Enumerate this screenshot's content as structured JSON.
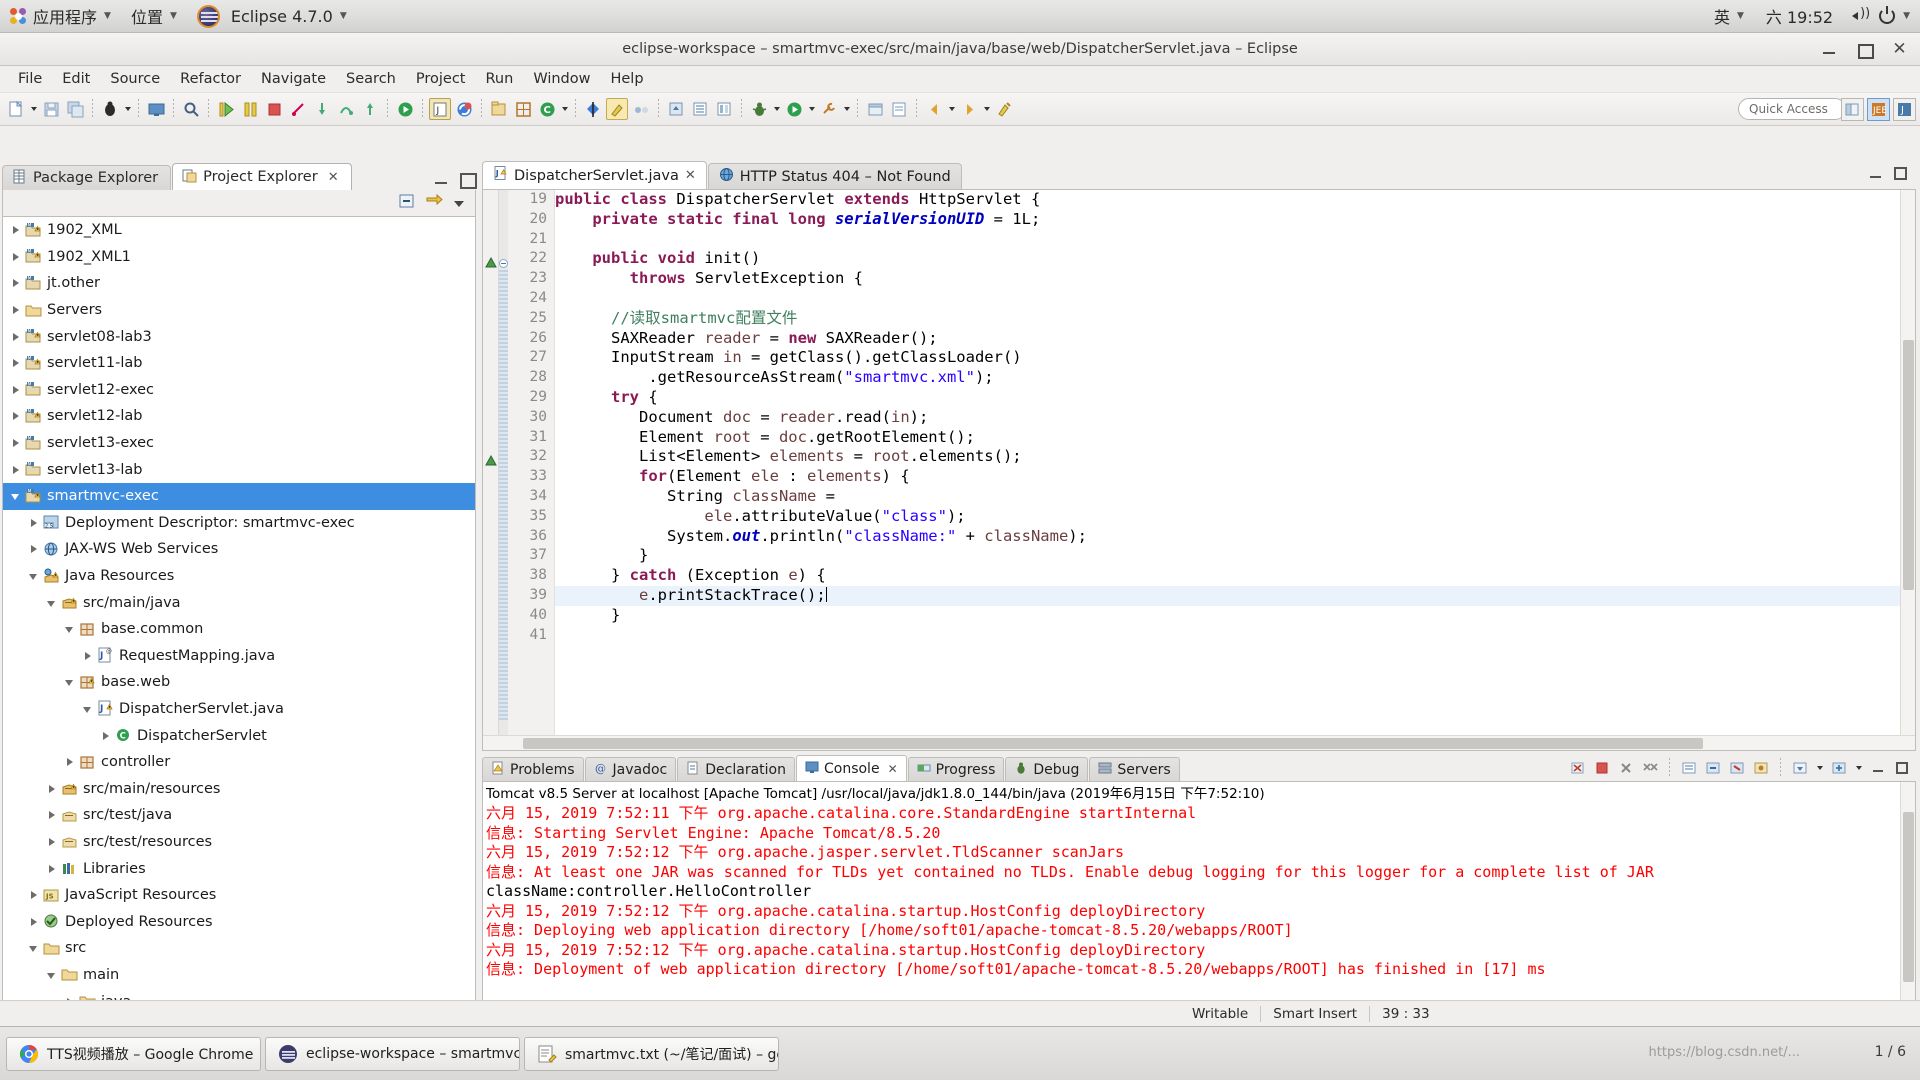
{
  "gnome_panel": {
    "applications_label": "应用程序",
    "places_label": "位置",
    "app_menu_label": "Eclipse 4.7.0",
    "input_method": "英",
    "clock": "六 19:52"
  },
  "window": {
    "title": "eclipse-workspace – smartmvc-exec/src/main/java/base/web/DispatcherServlet.java – Eclipse"
  },
  "menubar": [
    "File",
    "Edit",
    "Source",
    "Refactor",
    "Navigate",
    "Search",
    "Project",
    "Run",
    "Window",
    "Help"
  ],
  "toolbar": {
    "quick_access_placeholder": "Quick Access"
  },
  "left_view": {
    "tabs": [
      {
        "label": "Package Explorer",
        "active": false
      },
      {
        "label": "Project Explorer",
        "active": true
      }
    ],
    "tree": [
      {
        "label": "1902_XML",
        "depth": 0,
        "arrow": "right",
        "icon": "maven-project-warning"
      },
      {
        "label": "1902_XML1",
        "depth": 0,
        "arrow": "right",
        "icon": "maven-project-warning"
      },
      {
        "label": "jt.other",
        "depth": 0,
        "arrow": "right",
        "icon": "maven-project"
      },
      {
        "label": "Servers",
        "depth": 0,
        "arrow": "right",
        "icon": "folder"
      },
      {
        "label": "servlet08-lab3",
        "depth": 0,
        "arrow": "right",
        "icon": "maven-project-warning"
      },
      {
        "label": "servlet11-lab",
        "depth": 0,
        "arrow": "right",
        "icon": "maven-project-warning"
      },
      {
        "label": "servlet12-exec",
        "depth": 0,
        "arrow": "right",
        "icon": "maven-project"
      },
      {
        "label": "servlet12-lab",
        "depth": 0,
        "arrow": "right",
        "icon": "maven-project-warning"
      },
      {
        "label": "servlet13-exec",
        "depth": 0,
        "arrow": "right",
        "icon": "maven-project"
      },
      {
        "label": "servlet13-lab",
        "depth": 0,
        "arrow": "right",
        "icon": "maven-project"
      },
      {
        "label": "smartmvc-exec",
        "depth": 0,
        "arrow": "down",
        "icon": "maven-project-warning",
        "selected": true
      },
      {
        "label": "Deployment Descriptor: smartmvc-exec",
        "depth": 1,
        "arrow": "right",
        "icon": "deployment-descriptor"
      },
      {
        "label": "JAX-WS Web Services",
        "depth": 1,
        "arrow": "right",
        "icon": "jaxws"
      },
      {
        "label": "Java Resources",
        "depth": 1,
        "arrow": "down",
        "icon": "java-resources-warning"
      },
      {
        "label": "src/main/java",
        "depth": 2,
        "arrow": "down",
        "icon": "source-folder-warning"
      },
      {
        "label": "base.common",
        "depth": 3,
        "arrow": "down",
        "icon": "package"
      },
      {
        "label": "RequestMapping.java",
        "depth": 4,
        "arrow": "right",
        "icon": "annotation-file"
      },
      {
        "label": "base.web",
        "depth": 3,
        "arrow": "down",
        "icon": "package-warning"
      },
      {
        "label": "DispatcherServlet.java",
        "depth": 4,
        "arrow": "down",
        "icon": "java-file-warning"
      },
      {
        "label": "DispatcherServlet",
        "depth": 5,
        "arrow": "right",
        "icon": "class"
      },
      {
        "label": "controller",
        "depth": 3,
        "arrow": "right",
        "icon": "package"
      },
      {
        "label": "src/main/resources",
        "depth": 2,
        "arrow": "right",
        "icon": "source-folder-warning"
      },
      {
        "label": "src/test/java",
        "depth": 2,
        "arrow": "right",
        "icon": "source-folder"
      },
      {
        "label": "src/test/resources",
        "depth": 2,
        "arrow": "right",
        "icon": "source-folder"
      },
      {
        "label": "Libraries",
        "depth": 2,
        "arrow": "right",
        "icon": "libraries"
      },
      {
        "label": "JavaScript Resources",
        "depth": 1,
        "arrow": "right",
        "icon": "js-resources"
      },
      {
        "label": "Deployed Resources",
        "depth": 1,
        "arrow": "right",
        "icon": "deployed-resources"
      },
      {
        "label": "src",
        "depth": 1,
        "arrow": "down",
        "icon": "folder"
      },
      {
        "label": "main",
        "depth": 2,
        "arrow": "down",
        "icon": "folder"
      },
      {
        "label": "java",
        "depth": 3,
        "arrow": "right",
        "icon": "folder"
      }
    ]
  },
  "editor": {
    "tabs": [
      {
        "label": "DispatcherServlet.java",
        "active": true,
        "icon": "java-file-warning",
        "closable": true
      },
      {
        "label": "HTTP Status 404 – Not Found",
        "active": false,
        "icon": "globe",
        "closable": false
      }
    ],
    "first_line_number": 19,
    "lines": [
      {
        "n": 19,
        "segs": [
          {
            "t": "public ",
            "c": "kw"
          },
          {
            "t": "class ",
            "c": "kw"
          },
          {
            "t": "DispatcherServlet ",
            "c": "plain"
          },
          {
            "t": "extends ",
            "c": "kw"
          },
          {
            "t": "HttpServlet {",
            "c": "plain"
          }
        ]
      },
      {
        "n": 20,
        "segs": [
          {
            "t": "    ",
            "c": "plain"
          },
          {
            "t": "private static final ",
            "c": "kw"
          },
          {
            "t": "long ",
            "c": "kw"
          },
          {
            "t": "serialVersionUID",
            "c": "stat"
          },
          {
            "t": " = 1L;",
            "c": "plain"
          }
        ]
      },
      {
        "n": 21,
        "segs": []
      },
      {
        "n": 22,
        "segs": [
          {
            "t": "    ",
            "c": "plain"
          },
          {
            "t": "public void ",
            "c": "kw"
          },
          {
            "t": "init()",
            "c": "plain"
          }
        ],
        "fold": true,
        "marker": true
      },
      {
        "n": 23,
        "segs": [
          {
            "t": "        ",
            "c": "plain"
          },
          {
            "t": "throws ",
            "c": "kw"
          },
          {
            "t": "ServletException {",
            "c": "plain"
          }
        ]
      },
      {
        "n": 24,
        "segs": []
      },
      {
        "n": 25,
        "segs": [
          {
            "t": "      ",
            "c": "plain"
          },
          {
            "t": "//读取smartmvc配置文件",
            "c": "cmt"
          }
        ]
      },
      {
        "n": 26,
        "segs": [
          {
            "t": "      SAXReader ",
            "c": "plain"
          },
          {
            "t": "reader",
            "c": "loc"
          },
          {
            "t": " = ",
            "c": "plain"
          },
          {
            "t": "new ",
            "c": "kw"
          },
          {
            "t": "SAXReader();",
            "c": "plain"
          }
        ]
      },
      {
        "n": 27,
        "segs": [
          {
            "t": "      InputStream ",
            "c": "plain"
          },
          {
            "t": "in",
            "c": "loc"
          },
          {
            "t": " = getClass().getClassLoader()",
            "c": "plain"
          }
        ]
      },
      {
        "n": 28,
        "segs": [
          {
            "t": "          .getResourceAsStream(",
            "c": "plain"
          },
          {
            "t": "\"smartmvc.xml\"",
            "c": "str"
          },
          {
            "t": ");",
            "c": "plain"
          }
        ]
      },
      {
        "n": 29,
        "segs": [
          {
            "t": "      ",
            "c": "plain"
          },
          {
            "t": "try ",
            "c": "kw"
          },
          {
            "t": "{",
            "c": "plain"
          }
        ]
      },
      {
        "n": 30,
        "segs": [
          {
            "t": "         Document ",
            "c": "plain"
          },
          {
            "t": "doc",
            "c": "loc"
          },
          {
            "t": " = ",
            "c": "plain"
          },
          {
            "t": "reader",
            "c": "loc"
          },
          {
            "t": ".read(",
            "c": "plain"
          },
          {
            "t": "in",
            "c": "loc"
          },
          {
            "t": ");",
            "c": "plain"
          }
        ]
      },
      {
        "n": 31,
        "segs": [
          {
            "t": "         Element ",
            "c": "plain"
          },
          {
            "t": "root",
            "c": "loc"
          },
          {
            "t": " = ",
            "c": "plain"
          },
          {
            "t": "doc",
            "c": "loc"
          },
          {
            "t": ".getRootElement();",
            "c": "plain"
          }
        ]
      },
      {
        "n": 32,
        "segs": [
          {
            "t": "         List<Element> ",
            "c": "plain"
          },
          {
            "t": "elements",
            "c": "loc"
          },
          {
            "t": " = ",
            "c": "plain"
          },
          {
            "t": "root",
            "c": "loc"
          },
          {
            "t": ".elements();",
            "c": "plain"
          }
        ],
        "marker": true
      },
      {
        "n": 33,
        "segs": [
          {
            "t": "         ",
            "c": "plain"
          },
          {
            "t": "for",
            "c": "kw"
          },
          {
            "t": "(Element ",
            "c": "plain"
          },
          {
            "t": "ele",
            "c": "loc"
          },
          {
            "t": " : ",
            "c": "plain"
          },
          {
            "t": "elements",
            "c": "loc"
          },
          {
            "t": ") {",
            "c": "plain"
          }
        ]
      },
      {
        "n": 34,
        "segs": [
          {
            "t": "            String ",
            "c": "plain"
          },
          {
            "t": "className",
            "c": "loc"
          },
          {
            "t": " =",
            "c": "plain"
          }
        ]
      },
      {
        "n": 35,
        "segs": [
          {
            "t": "                ",
            "c": "plain"
          },
          {
            "t": "ele",
            "c": "loc"
          },
          {
            "t": ".attributeValue(",
            "c": "plain"
          },
          {
            "t": "\"class\"",
            "c": "str"
          },
          {
            "t": ");",
            "c": "plain"
          }
        ]
      },
      {
        "n": 36,
        "segs": [
          {
            "t": "            System.",
            "c": "plain"
          },
          {
            "t": "out",
            "c": "stat"
          },
          {
            "t": ".println(",
            "c": "plain"
          },
          {
            "t": "\"className:\"",
            "c": "str"
          },
          {
            "t": " + ",
            "c": "plain"
          },
          {
            "t": "className",
            "c": "loc"
          },
          {
            "t": ");",
            "c": "plain"
          }
        ]
      },
      {
        "n": 37,
        "segs": [
          {
            "t": "         }",
            "c": "plain"
          }
        ]
      },
      {
        "n": 38,
        "segs": [
          {
            "t": "      } ",
            "c": "plain"
          },
          {
            "t": "catch ",
            "c": "kw"
          },
          {
            "t": "(Exception ",
            "c": "plain"
          },
          {
            "t": "e",
            "c": "loc"
          },
          {
            "t": ") {",
            "c": "plain"
          }
        ]
      },
      {
        "n": 39,
        "segs": [
          {
            "t": "         ",
            "c": "plain"
          },
          {
            "t": "e",
            "c": "loc"
          },
          {
            "t": ".printStackTrace();",
            "c": "plain"
          }
        ],
        "highlight": true,
        "caret": true
      },
      {
        "n": 40,
        "segs": [
          {
            "t": "      }",
            "c": "plain"
          }
        ]
      },
      {
        "n": 41,
        "segs": []
      }
    ]
  },
  "console": {
    "tabs": [
      {
        "label": "Problems",
        "active": false,
        "icon": "problems-icon"
      },
      {
        "label": "Javadoc",
        "active": false,
        "icon": "javadoc-icon"
      },
      {
        "label": "Declaration",
        "active": false,
        "icon": "declaration-icon"
      },
      {
        "label": "Console",
        "active": true,
        "icon": "console-icon"
      },
      {
        "label": "Progress",
        "active": false,
        "icon": "progress-icon"
      },
      {
        "label": "Debug",
        "active": false,
        "icon": "debug-icon"
      },
      {
        "label": "Servers",
        "active": false,
        "icon": "servers-icon"
      }
    ],
    "header": "Tomcat v8.5 Server at localhost [Apache Tomcat] /usr/local/java/jdk1.8.0_144/bin/java (2019年6月15日 下午7:52:10)",
    "lines": [
      {
        "text": "六月 15, 2019 7:52:11 下午 org.apache.catalina.core.StandardEngine startInternal",
        "color": "red"
      },
      {
        "text": "信息: Starting Servlet Engine: Apache Tomcat/8.5.20",
        "color": "red"
      },
      {
        "text": "六月 15, 2019 7:52:12 下午 org.apache.jasper.servlet.TldScanner scanJars",
        "color": "red"
      },
      {
        "text": "信息: At least one JAR was scanned for TLDs yet contained no TLDs. Enable debug logging for this logger for a complete list of JAR",
        "color": "red"
      },
      {
        "text": "className:controller.HelloController",
        "color": "black"
      },
      {
        "text": "六月 15, 2019 7:52:12 下午 org.apache.catalina.startup.HostConfig deployDirectory",
        "color": "red"
      },
      {
        "text": "信息: Deploying web application directory [/home/soft01/apache-tomcat-8.5.20/webapps/ROOT]",
        "color": "red"
      },
      {
        "text": "六月 15, 2019 7:52:12 下午 org.apache.catalina.startup.HostConfig deployDirectory",
        "color": "red"
      },
      {
        "text": "信息: Deployment of web application directory [/home/soft01/apache-tomcat-8.5.20/webapps/ROOT] has finished in [17] ms",
        "color": "red"
      }
    ]
  },
  "statusbar": {
    "writable": "Writable",
    "insert_mode": "Smart Insert",
    "position": "39 : 33"
  },
  "taskbar": {
    "items": [
      {
        "label": "TTS视频播放 – Google Chrome",
        "icon": "chrome-icon"
      },
      {
        "label": "eclipse-workspace – smartmvc-e...",
        "icon": "eclipse-icon"
      },
      {
        "label": "smartmvc.txt (~/笔记/面试) – gedit",
        "icon": "gedit-icon"
      }
    ],
    "watermark": "https://blog.csdn.net/...",
    "pager": "1 / 6"
  },
  "colors": {
    "selection_blue": "#3d8de0",
    "console_red": "#ff0000",
    "keyword_purple": "#8a1a55",
    "string_blue": "#2a00ff",
    "comment_green": "#3f7f5f"
  }
}
